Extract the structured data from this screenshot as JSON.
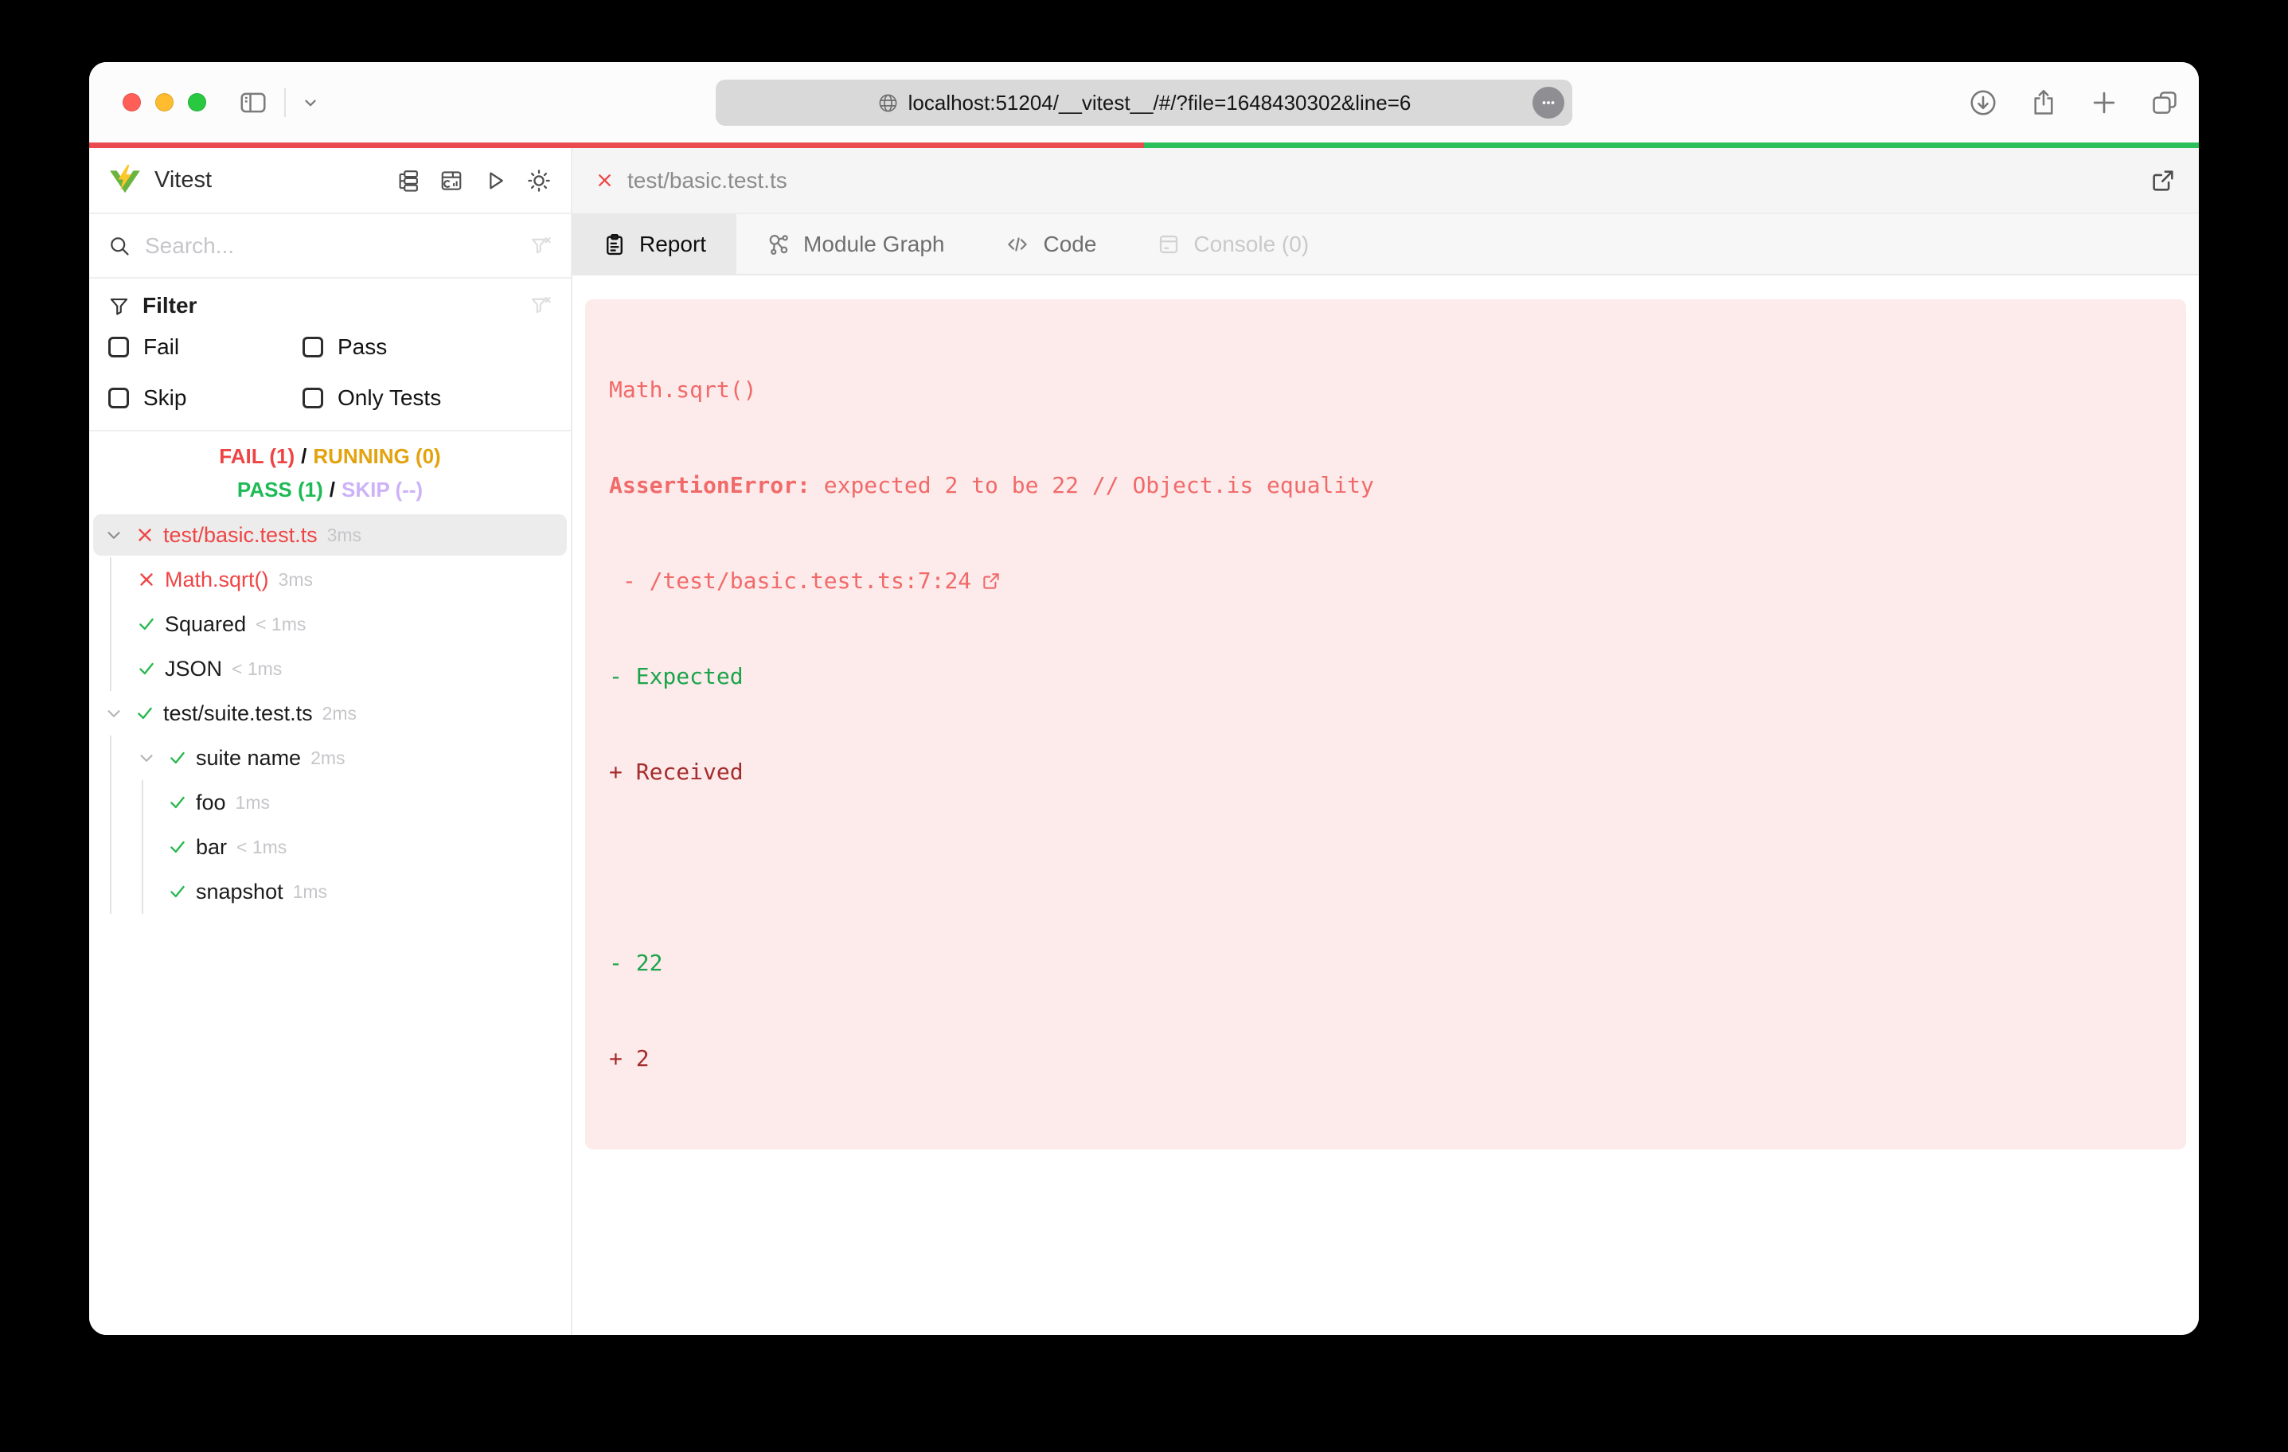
{
  "browser": {
    "url": "localhost:51204/__vitest__/#/?file=1648430302&line=6",
    "traffic_lights": [
      "#ff5f57",
      "#febc2e",
      "#28c840"
    ],
    "progress": {
      "fail_fraction": 0.5,
      "fail_color": "#e94b4e",
      "pass_color": "#2cc05b"
    }
  },
  "sidebar": {
    "app_title": "Vitest",
    "search": {
      "placeholder": "Search..."
    },
    "filter": {
      "title": "Filter",
      "checkboxes": [
        {
          "label": "Fail",
          "checked": false
        },
        {
          "label": "Pass",
          "checked": false
        },
        {
          "label": "Skip",
          "checked": false
        },
        {
          "label": "Only Tests",
          "checked": false
        }
      ]
    },
    "status": {
      "fail": "FAIL (1)",
      "running": "RUNNING (0)",
      "pass": "PASS (1)",
      "skip": "SKIP (--)",
      "separator": "/"
    },
    "status_colors": {
      "fail": "#ef4444",
      "running": "#e3a30f",
      "pass": "#1fba55",
      "skip": "#cdb2f8"
    },
    "tree": [
      {
        "label": "test/basic.test.ts",
        "duration": "3ms",
        "status": "fail",
        "depth": 0,
        "expanded": true,
        "selected": true
      },
      {
        "label": "Math.sqrt()",
        "duration": "3ms",
        "status": "fail",
        "depth": 1
      },
      {
        "label": "Squared",
        "duration": "< 1ms",
        "status": "pass",
        "depth": 1
      },
      {
        "label": "JSON",
        "duration": "< 1ms",
        "status": "pass",
        "depth": 1
      },
      {
        "label": "test/suite.test.ts",
        "duration": "2ms",
        "status": "pass",
        "depth": 0,
        "expanded": true
      },
      {
        "label": "suite name",
        "duration": "2ms",
        "status": "pass",
        "depth": 1,
        "expanded": true
      },
      {
        "label": "foo",
        "duration": "1ms",
        "status": "pass",
        "depth": 2
      },
      {
        "label": "bar",
        "duration": "< 1ms",
        "status": "pass",
        "depth": 2
      },
      {
        "label": "snapshot",
        "duration": "1ms",
        "status": "pass",
        "depth": 2
      }
    ]
  },
  "main": {
    "file_tab": {
      "label": "test/basic.test.ts",
      "status": "fail"
    },
    "tabs": [
      {
        "label": "Report",
        "state": "active"
      },
      {
        "label": "Module Graph",
        "state": "normal"
      },
      {
        "label": "Code",
        "state": "normal"
      },
      {
        "label": "Console (0)",
        "state": "disabled"
      }
    ],
    "error_panel": {
      "test_name": "Math.sqrt()",
      "error_name": "AssertionError:",
      "error_message": " expected 2 to be 22 // Object.is equality",
      "stack_prefix": " - ",
      "stack_location": "/test/basic.test.ts:7:24",
      "diff_expected_label": "- Expected",
      "diff_received_label": "+ Received",
      "diff_expected_value": "- 22",
      "diff_received_value": "+ 2"
    }
  }
}
